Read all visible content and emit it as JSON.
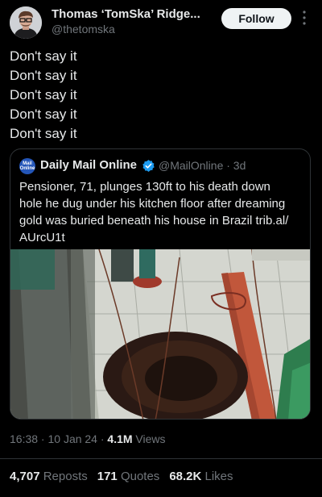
{
  "author": {
    "name": "Thomas ‘TomSka’ Ridge...",
    "handle": "@thetomska",
    "follow_label": "Follow"
  },
  "post": {
    "lines": [
      "Don't say it",
      "Don't say it",
      "Don't say it",
      "Don't say it",
      "Don't say it"
    ]
  },
  "quoted": {
    "logo_text": "Mail Online",
    "name": "Daily Mail Online",
    "handle_time": "@MailOnline · 3d",
    "text": "Pensioner, 71, plunges 130ft to his death down\nhole he dug under his kitchen floor after dreaming\ngold was buried beneath his house in Brazil trib.al/\nAUrcU1t"
  },
  "meta": {
    "time": "16:38 · 10 Jan 24 · ",
    "views_count": "4.1M",
    "views_label": " Views"
  },
  "stats": {
    "reposts_count": "4,707",
    "reposts_label": " Reposts",
    "quotes_count": "171",
    "quotes_label": " Quotes",
    "likes_count": "68.2K",
    "likes_label": " Likes"
  },
  "colors": {
    "background": "#000000",
    "text_primary": "#e7e9ea",
    "text_secondary": "#71767b",
    "verified": "#1d9bf0",
    "border": "#2f3336"
  }
}
